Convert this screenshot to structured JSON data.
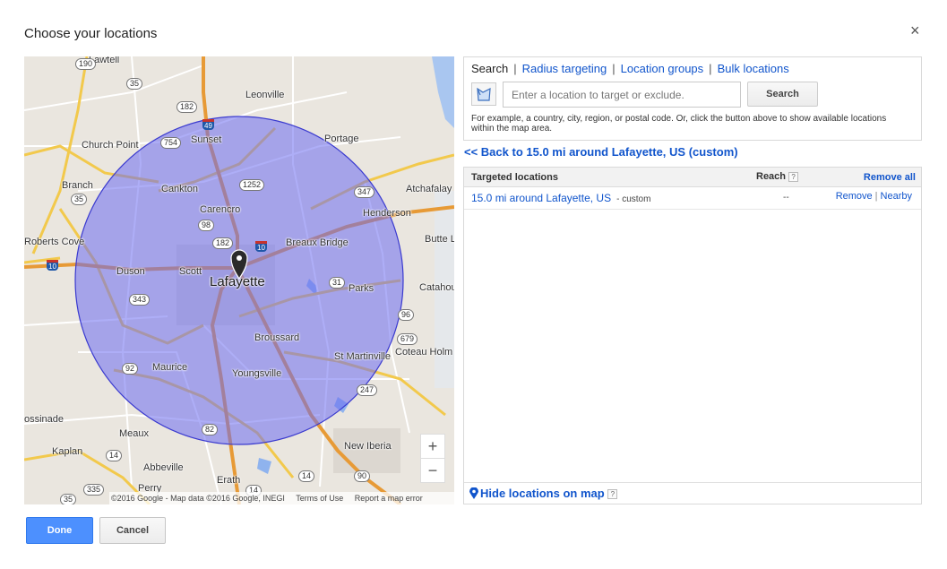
{
  "dialog": {
    "title": "Choose your locations",
    "close_icon": "close-icon",
    "close_glyph": "×"
  },
  "map": {
    "places": {
      "lawtell": "Lawtell",
      "leonville": "Leonville",
      "church_point": "Church Point",
      "sunset": "Sunset",
      "portage": "Portage",
      "branch": "Branch",
      "cankton": "Cankton",
      "carencro": "Carencro",
      "atchafalaya": "Atchafalay",
      "henderson": "Henderson",
      "roberts_cove": "Roberts Cove",
      "breaux_bridge": "Breaux Bridge",
      "butte_la": "Butte L",
      "duson": "Duson",
      "scott": "Scott",
      "lafayette": "Lafayette",
      "parks": "Parks",
      "catahoula": "Catahou",
      "broussard": "Broussard",
      "maurice": "Maurice",
      "st_martinville": "St Martinville",
      "coteau_holmes": "Coteau Holm",
      "youngsville": "Youngsville",
      "cossinade": "ossinade",
      "meaux": "Meaux",
      "new_iberia": "New Iberia",
      "kaplan": "Kaplan",
      "abbeville": "Abbeville",
      "erath": "Erath",
      "perry": "Perry"
    },
    "shields": {
      "r190": "190",
      "r35a": "35",
      "r182a": "182",
      "r754": "754",
      "r1252": "1252",
      "r347": "347",
      "r35b": "35",
      "r98": "98",
      "r182b": "182",
      "r343": "343",
      "r31": "31",
      "r96": "96",
      "r679": "679",
      "r92": "92",
      "r247": "247",
      "r82": "82",
      "r14a": "14",
      "r14b": "14",
      "r14c": "14",
      "r335": "335",
      "r35c": "35",
      "r90": "90",
      "i49": "49",
      "i10a": "10",
      "i10b": "10"
    },
    "zoom_in": "+",
    "zoom_out": "−",
    "attribution": {
      "copyright": "©2016 Google - Map data ©2016 Google, INEGI",
      "terms": "Terms of Use",
      "report": "Report a map error"
    },
    "radius_color": "#6b6bf0",
    "pin_icon": "map-pin-icon"
  },
  "search": {
    "tabs": [
      {
        "label": "Search",
        "active": true
      },
      {
        "label": "Radius targeting",
        "active": false
      },
      {
        "label": "Location groups",
        "active": false
      },
      {
        "label": "Bulk locations",
        "active": false
      }
    ],
    "separator": "|",
    "placeholder": "Enter a location to target or exclude.",
    "value": "",
    "button_label": "Search",
    "hint": "For example, a country, city, region, or postal code. Or, click the button above to show available locations within the map area.",
    "map_button_icon": "map-select-icon"
  },
  "back_link": "<< Back to 15.0 mi around Lafayette, US (custom)",
  "targeted": {
    "headers": {
      "location": "Targeted locations",
      "reach": "Reach",
      "help": "?",
      "remove_all": "Remove all"
    },
    "rows": [
      {
        "location": "15.0 mi around Lafayette, US",
        "kind": "- custom",
        "reach": "--",
        "remove": "Remove",
        "bar": "|",
        "nearby": "Nearby"
      }
    ],
    "footer": {
      "hide_label": "Hide locations on map",
      "help": "?"
    }
  },
  "actions": {
    "done": "Done",
    "cancel": "Cancel"
  },
  "colors": {
    "link": "#1155cc",
    "primary_button": "#4d90fe",
    "interstate": "#1f57a8"
  }
}
